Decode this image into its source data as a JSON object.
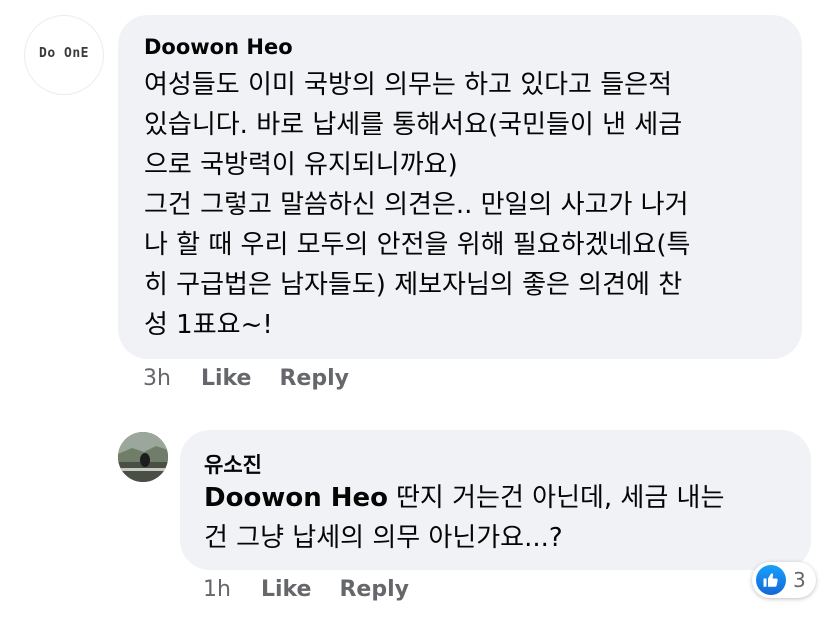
{
  "comment": {
    "avatar_logo_text": "Do OnE",
    "author": "Doowon Heo",
    "text_lines": [
      "여성들도 이미 국방의 의무는 하고 있다고 들은적",
      "있습니다. 바로 납세를 통해서요(국민들이 낸 세금",
      "으로 국방력이 유지되니까요)",
      "그건 그렇고 말씀하신 의견은.. 만일의 사고가 나거",
      "나 할 때 우리 모두의 안전을 위해 필요하겠네요(특",
      "히 구급법은 남자들도) 제보자님의 좋은 의견에 찬",
      "성 1표요~!"
    ],
    "time": "3h",
    "like_label": "Like",
    "reply_label": "Reply"
  },
  "reply": {
    "author": "유소진",
    "mention": "Doowon Heo",
    "text_lines": [
      "딴지 거는건 아닌데, 세금 내는",
      "건 그냥 납세의 의무 아닌가요...?"
    ],
    "time": "1h",
    "like_label": "Like",
    "reply_label": "Reply",
    "reaction_icon": "thumbs-up-icon",
    "reaction_count": "3"
  },
  "colors": {
    "bubble_bg": "#f0f2f5",
    "meta_text": "#65676b",
    "like_blue": "#1877f2"
  }
}
